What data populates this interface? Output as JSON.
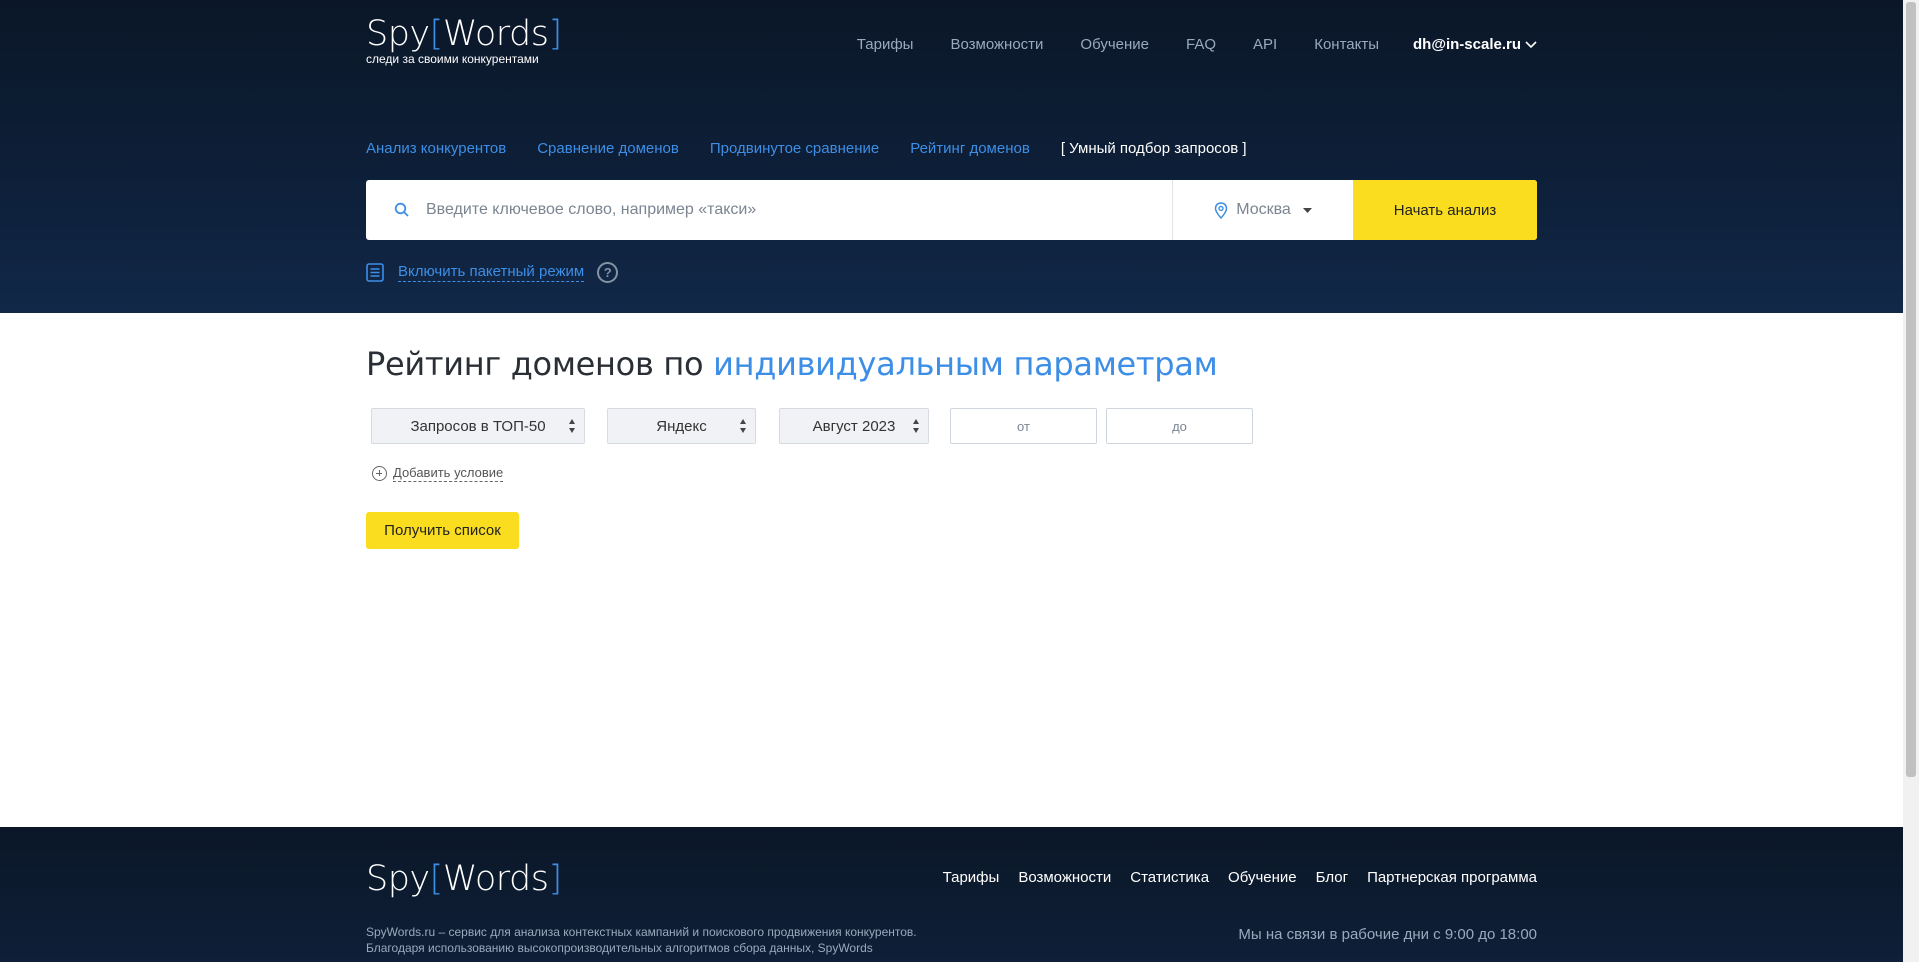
{
  "brand": {
    "name_a": "Spy",
    "bracket_open": "[",
    "name_b": "Words",
    "bracket_close": "]",
    "tagline": "следи за своими конкурентами",
    "accent_color": "#3d8ee6",
    "cta_color": "#f9dd1e"
  },
  "topnav": {
    "items": [
      "Тарифы",
      "Возможности",
      "Обучение",
      "FAQ",
      "API",
      "Контакты"
    ],
    "user": "dh@in-scale.ru",
    "user_icon": "chevron-down-icon"
  },
  "tabs": {
    "items": [
      "Анализ конкурентов",
      "Сравнение доменов",
      "Продвинутое сравнение",
      "Рейтинг доменов"
    ],
    "active": "[ Умный подбор запросов ]"
  },
  "search": {
    "placeholder": "Введите ключевое слово, например «такси»",
    "region": "Москва",
    "submit": "Начать анализ"
  },
  "batch": {
    "label": "Включить пакетный режим",
    "help": "?"
  },
  "page": {
    "title_plain": "Рейтинг доменов по ",
    "title_accent": "индивидуальным параметрам"
  },
  "filters": {
    "metric": "Запросов в ТОП-50",
    "engine": "Яндекс",
    "period": "Август 2023",
    "from_placeholder": "от",
    "to_placeholder": "до",
    "add_condition": "Добавить условие",
    "submit": "Получить список"
  },
  "footer": {
    "nav": [
      "Тарифы",
      "Возможности",
      "Статистика",
      "Обучение",
      "Блог",
      "Партнерская программа"
    ],
    "desc_line1": "SpyWords.ru – сервис для анализа контекстных кампаний и поискового продвижения конкурентов.",
    "desc_line2": "Благодаря использованию высокопроизводительных алгоритмов сбора данных, SpyWords",
    "hours": "Мы на связи в рабочие дни с 9:00 до 18:00"
  }
}
